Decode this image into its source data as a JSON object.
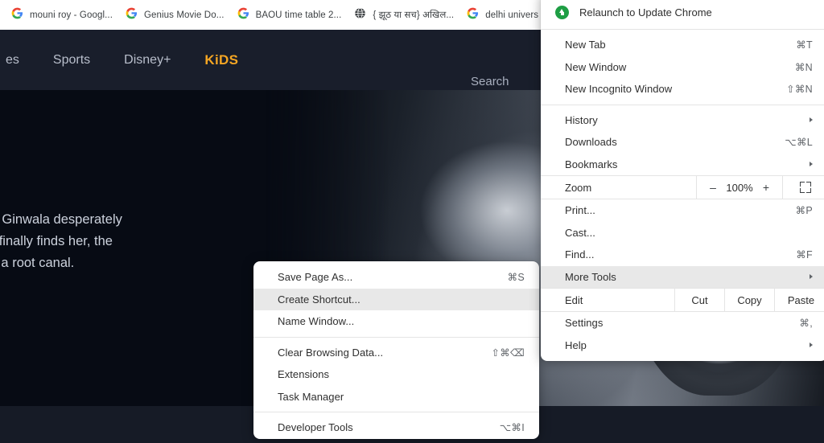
{
  "bookmarks_bar": {
    "items": [
      {
        "label": "mouni roy - Googl...",
        "icon": "google-g-icon"
      },
      {
        "label": "Genius Movie Do...",
        "icon": "google-g-icon"
      },
      {
        "label": "BAOU time table 2...",
        "icon": "google-g-icon"
      },
      {
        "label": "{ झूठ या सच} अखिल...",
        "icon": "globe-icon"
      },
      {
        "label": "delhi univers",
        "icon": "google-g-icon"
      }
    ]
  },
  "site": {
    "nav": [
      {
        "label": "es",
        "accent": false
      },
      {
        "label": "Sports",
        "accent": false
      },
      {
        "label": "Disney+",
        "accent": false
      },
      {
        "label": "KiDS",
        "accent": true
      }
    ],
    "search": {
      "value": "",
      "placeholder": "Search"
    },
    "hero": {
      "line1": "eddy Ginwala desperately",
      "line2": "h he finally finds her, the",
      "line3": "ul as a root canal."
    },
    "colors": {
      "nav_bg": "#191e2b",
      "page_bg": "#0b0f1a",
      "kids_accent": "#f5a623"
    }
  },
  "chrome_menu": {
    "relaunch": {
      "label": "Relaunch to Update Chrome",
      "icon": "update-arrow-icon"
    },
    "group1": [
      {
        "label": "New Tab",
        "accel": "⌘T"
      },
      {
        "label": "New Window",
        "accel": "⌘N"
      },
      {
        "label": "New Incognito Window",
        "accel": "⇧⌘N"
      }
    ],
    "group2": [
      {
        "label": "History",
        "accel": "",
        "submenu": true
      },
      {
        "label": "Downloads",
        "accel": "⌥⌘L",
        "submenu": false
      },
      {
        "label": "Bookmarks",
        "accel": "",
        "submenu": true
      }
    ],
    "zoom": {
      "label": "Zoom",
      "minus": "–",
      "value": "100%",
      "plus": "+",
      "fullscreen_icon": "fullscreen-icon"
    },
    "group3": [
      {
        "label": "Print...",
        "accel": "⌘P",
        "submenu": false,
        "highlighted": false
      },
      {
        "label": "Cast...",
        "accel": "",
        "submenu": false,
        "highlighted": false
      },
      {
        "label": "Find...",
        "accel": "⌘F",
        "submenu": false,
        "highlighted": false
      },
      {
        "label": "More Tools",
        "accel": "",
        "submenu": true,
        "highlighted": true
      }
    ],
    "edit": {
      "label": "Edit",
      "cut": "Cut",
      "copy": "Copy",
      "paste": "Paste"
    },
    "group4": [
      {
        "label": "Settings",
        "accel": "⌘,",
        "submenu": false
      },
      {
        "label": "Help",
        "accel": "",
        "submenu": true
      }
    ]
  },
  "more_tools_submenu": {
    "group1": [
      {
        "label": "Save Page As...",
        "accel": "⌘S",
        "highlighted": false
      },
      {
        "label": "Create Shortcut...",
        "accel": "",
        "highlighted": true
      },
      {
        "label": "Name Window...",
        "accel": "",
        "highlighted": false
      }
    ],
    "group2": [
      {
        "label": "Clear Browsing Data...",
        "accel": "⇧⌘⌫",
        "highlighted": false
      },
      {
        "label": "Extensions",
        "accel": "",
        "highlighted": false
      },
      {
        "label": "Task Manager",
        "accel": "",
        "highlighted": false
      }
    ],
    "group3": [
      {
        "label": "Developer Tools",
        "accel": "⌥⌘I",
        "highlighted": false
      }
    ]
  }
}
